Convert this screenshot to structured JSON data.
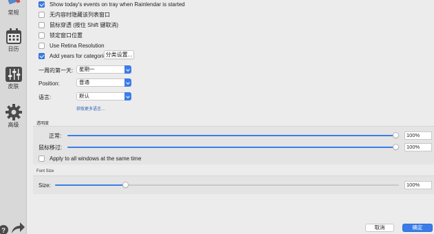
{
  "sidebar": {
    "items": [
      {
        "label": "常规"
      },
      {
        "label": "日历"
      },
      {
        "label": "皮肤"
      },
      {
        "label": "高级"
      }
    ]
  },
  "checkboxes": [
    {
      "label": "Show today's events on tray when Rainlendar is started",
      "checked": true
    },
    {
      "label": "无内容时隐藏该列表窗口",
      "checked": false
    },
    {
      "label": "鼠标穿透 (按住 Shift 键取消)",
      "checked": false
    },
    {
      "label": "锁定窗口位置",
      "checked": false
    },
    {
      "label": "Use Retina Resolution",
      "checked": false
    },
    {
      "label": "Add years for categories",
      "checked": true
    }
  ],
  "category_settings_button": "分类设置...",
  "form": {
    "first_day": {
      "label": "一周的第一天:",
      "value": "星期一"
    },
    "position": {
      "label": "Position:",
      "value": "普通"
    },
    "language": {
      "label": "语言:",
      "value": "默认"
    },
    "more_languages_link": "获取更多语言..."
  },
  "transparency": {
    "title": "透明度",
    "normal": {
      "label": "正常:",
      "value": "100%",
      "level": 1.0
    },
    "hover": {
      "label": "鼠标移过:",
      "value": "100%",
      "level": 1.0
    },
    "apply_all": {
      "label": "Apply to all windows at the same time",
      "checked": false
    }
  },
  "font_size": {
    "title": "Font Size",
    "size": {
      "label": "Size:",
      "value": "100%",
      "level": 0.2
    }
  },
  "footer": {
    "cancel": "取消",
    "ok": "确定"
  },
  "colors": {
    "accent": "#3b7ce8",
    "link": "#2a5db0"
  }
}
